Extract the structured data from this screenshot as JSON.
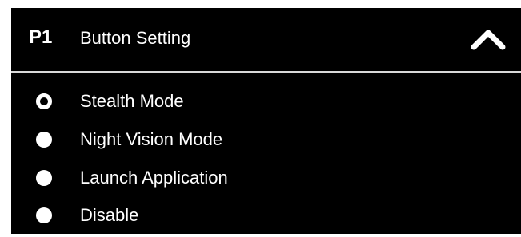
{
  "header": {
    "profile": "P1",
    "title": "Button Setting",
    "toggle_icon": "chevron-up-icon"
  },
  "options": [
    {
      "label": "Stealth Mode",
      "selected": true
    },
    {
      "label": "Night Vision Mode",
      "selected": false
    },
    {
      "label": "Launch Application",
      "selected": false
    },
    {
      "label": "Disable",
      "selected": false
    }
  ],
  "colors": {
    "background": "#000000",
    "text": "#ffffff",
    "divider": "#d9d9d9"
  }
}
